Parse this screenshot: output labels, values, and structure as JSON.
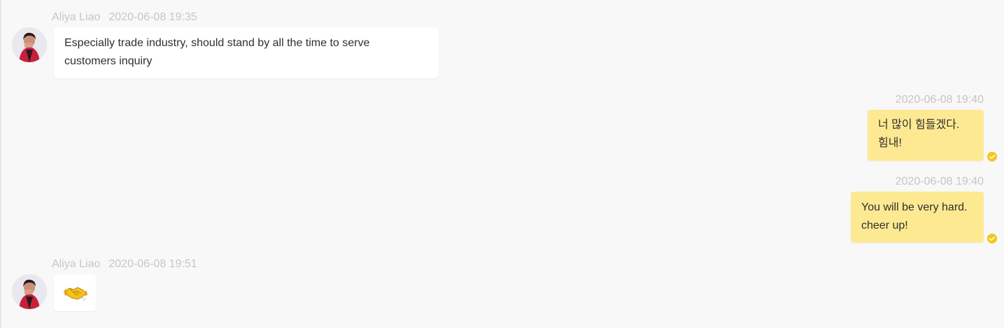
{
  "messages": [
    {
      "direction": "incoming",
      "sender": "Aliya Liao",
      "timestamp": "2020-06-08 19:35",
      "lines": [
        "Especially trade industry, should stand by all the time to serve",
        "customers inquiry"
      ]
    },
    {
      "direction": "outgoing",
      "timestamp": "2020-06-08 19:40",
      "lines": [
        "너 많이 힘들겠다.",
        "힘내!"
      ],
      "status": "read"
    },
    {
      "direction": "outgoing",
      "timestamp": "2020-06-08 19:40",
      "lines": [
        "You will be very hard.",
        "cheer up!"
      ],
      "status": "read"
    },
    {
      "direction": "incoming",
      "sender": "Aliya Liao",
      "timestamp": "2020-06-08 19:51",
      "sticker": "handshake-emoji"
    }
  ],
  "colors": {
    "background": "#f8f8f8",
    "incoming_bubble": "#ffffff",
    "outgoing_bubble": "#fde992",
    "read_check": "#f5c518",
    "meta_text": "#c6c6c6",
    "message_text": "#2f2f2f"
  }
}
